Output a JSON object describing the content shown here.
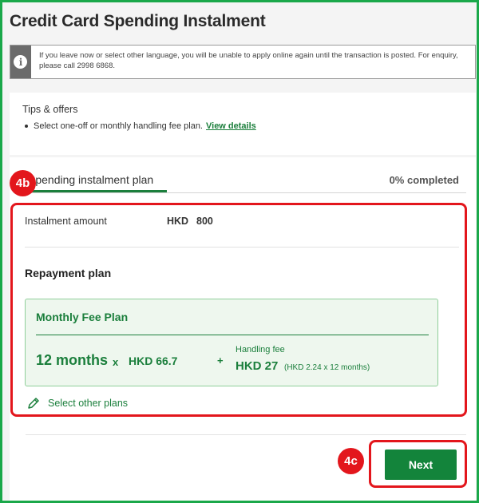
{
  "page": {
    "title": "Credit Card Spending Instalment"
  },
  "notice": {
    "icon": "info-icon",
    "text": "If you leave now or select other language, you will be unable to apply online again until the transaction is posted. For enquiry, please call 2998 6868."
  },
  "tips": {
    "title": "Tips & offers",
    "text": "Select one-off or monthly handling fee plan.",
    "link": "View details"
  },
  "tab": {
    "label": "Spending instalment plan",
    "progress": "0% completed"
  },
  "amount": {
    "label": "Instalment amount",
    "currency": "HKD",
    "value": "800"
  },
  "repayment": {
    "title": "Repayment plan",
    "plan": {
      "name": "Monthly Fee Plan",
      "months": "12 months",
      "times": "x",
      "per_month": "HKD 66.7",
      "plus": "+",
      "fee_label": "Handling fee",
      "fee_value": "HKD 27",
      "fee_note": "(HKD 2.24 x 12 months)"
    },
    "other_plans": "Select other plans"
  },
  "actions": {
    "next": "Next"
  },
  "annotations": {
    "badge_a": "4b",
    "badge_b": "4c"
  },
  "colors": {
    "brand_green": "#1b7f3c",
    "button_green": "#13843b",
    "callout_red": "#e3161c",
    "frame_green": "#1aa84a"
  }
}
